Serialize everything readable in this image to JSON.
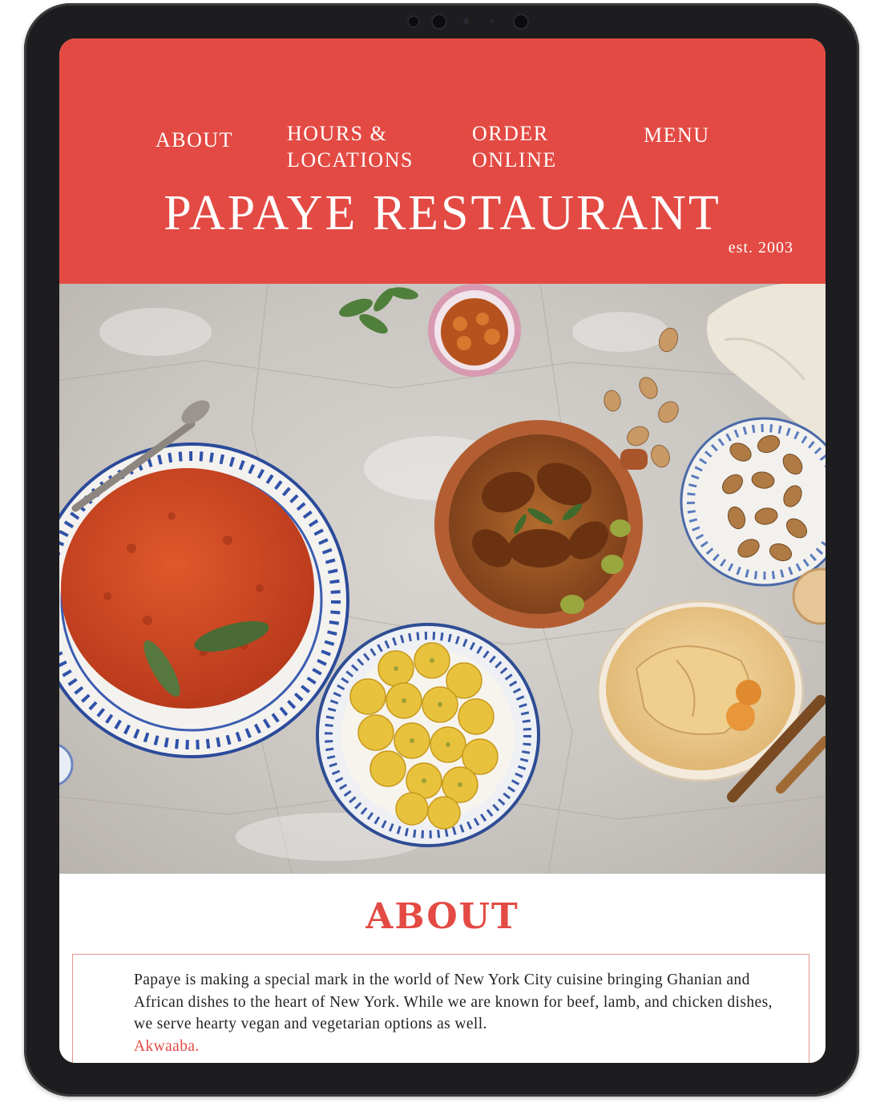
{
  "nav": {
    "about": "ABOUT",
    "hours": "HOURS &\nLOCATIONS",
    "order": "ORDER\nONLINE",
    "menu": "MENU"
  },
  "brand": {
    "name": "PAPAYE RESTAURANT",
    "established": "est. 2003"
  },
  "about": {
    "heading": "ABOUT",
    "body": "Papaye is making a special mark in the world of New York City cuisine bringing Ghanian  and African dishes to the heart of New York. While we are known for beef, lamb, and chicken dishes, we serve hearty vegan and vegetarian options as well.",
    "greeting": "Akwaaba."
  },
  "colors": {
    "accent": "#e34a43",
    "device_frame": "#1d1d1f"
  }
}
